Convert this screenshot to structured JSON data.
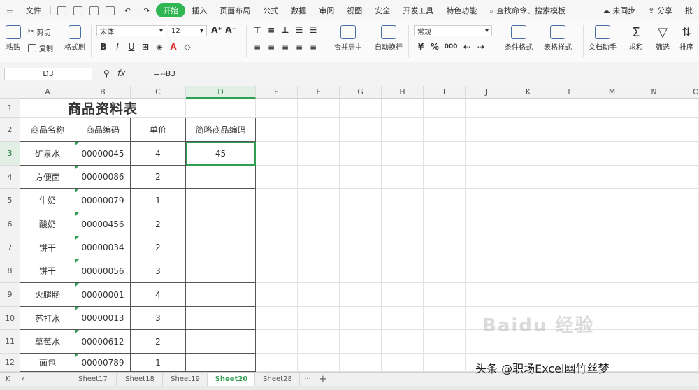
{
  "menubar": {
    "file": "文件",
    "quick_icons": [
      "save-icon",
      "print-icon",
      "preview-icon",
      "export-icon",
      "undo-icon",
      "redo-icon"
    ],
    "tabs": [
      "开始",
      "插入",
      "页面布局",
      "公式",
      "数据",
      "审阅",
      "视图",
      "安全",
      "开发工具",
      "特色功能"
    ],
    "active_tab": "开始",
    "search": "查找命令、搜索模板",
    "unsynced": "未同步",
    "share": "分享",
    "comment": "批"
  },
  "ribbon": {
    "paste": "粘贴",
    "cut": "剪切",
    "copy": "复制",
    "format_painter": "格式刷",
    "font_name": "宋体",
    "font_size": "12",
    "bold": "B",
    "italic": "I",
    "underline": "U",
    "merge_center": "合并居中",
    "wrap_text": "自动换行",
    "number_format": "常规",
    "percent": "%",
    "thousands": "000",
    "cond_format": "条件格式",
    "table_style": "表格样式",
    "doc_helper": "文档助手",
    "sum": "求和",
    "filter": "筛选",
    "sort": "排序"
  },
  "formula_bar": {
    "name_box": "D3",
    "fx": "fx",
    "formula": "=--B3"
  },
  "grid": {
    "columns": [
      "A",
      "B",
      "C",
      "D",
      "E",
      "F",
      "G",
      "H",
      "I",
      "J",
      "K",
      "L",
      "M",
      "N",
      "O"
    ],
    "selected_column": "D",
    "row_numbers": [
      "1",
      "2",
      "3",
      "4",
      "5",
      "6",
      "7",
      "8",
      "9",
      "10",
      "11",
      "12"
    ],
    "selected_row": "3",
    "title": "商品资料表",
    "headers": [
      "商品名称",
      "商品编码",
      "单价",
      "简略商品编码"
    ],
    "rows": [
      [
        "矿泉水",
        "00000045",
        "4",
        "45"
      ],
      [
        "方便面",
        "00000086",
        "2",
        ""
      ],
      [
        "牛奶",
        "00000079",
        "1",
        ""
      ],
      [
        "酸奶",
        "00000456",
        "2",
        ""
      ],
      [
        "饼干",
        "00000034",
        "2",
        ""
      ],
      [
        "饼干",
        "00000056",
        "3",
        ""
      ],
      [
        "火腿肠",
        "00000001",
        "4",
        ""
      ],
      [
        "苏打水",
        "00000013",
        "3",
        ""
      ],
      [
        "草莓水",
        "00000612",
        "2",
        ""
      ],
      [
        "面包",
        "00000789",
        "1",
        ""
      ]
    ]
  },
  "sheet_tabs": {
    "sheets": [
      "Sheet17",
      "Sheet18",
      "Sheet19",
      "Sheet20",
      "Sheet28"
    ],
    "active": "Sheet20",
    "more": "···",
    "add": "+"
  },
  "watermark": {
    "baidu": "Baidu 经验",
    "credit": "头条 @职场Excel幽竹丝梦"
  },
  "colors": {
    "accent": "#2e9e50",
    "active_tab_bg": "#2fb551"
  }
}
